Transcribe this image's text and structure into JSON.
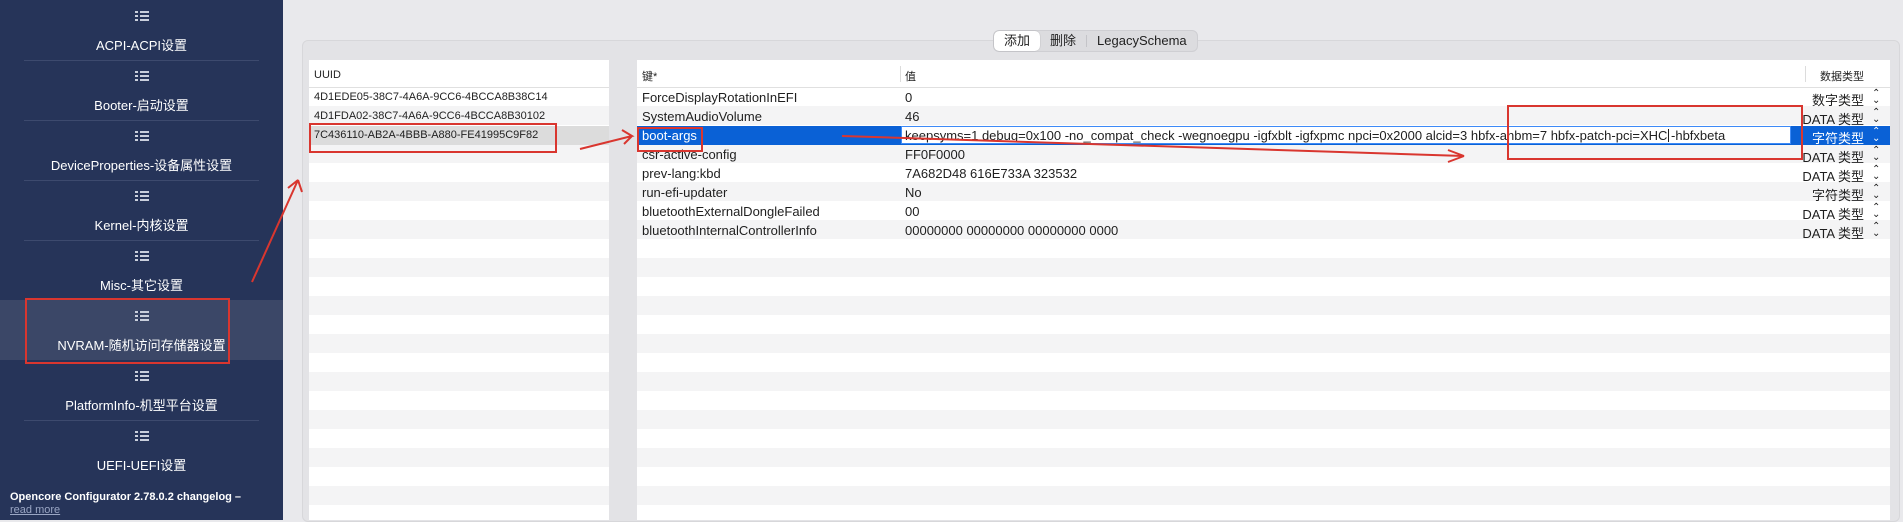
{
  "sidebar": {
    "items": [
      {
        "label": "ACPI-ACPI设置"
      },
      {
        "label": "Booter-启动设置"
      },
      {
        "label": "DeviceProperties-设备属性设置"
      },
      {
        "label": "Kernel-内核设置"
      },
      {
        "label": "Misc-其它设置"
      },
      {
        "label": "NVRAM-随机访问存储器设置"
      },
      {
        "label": "PlatformInfo-机型平台设置"
      },
      {
        "label": "UEFI-UEFI设置"
      }
    ],
    "selected_index": 5,
    "changelog": "Opencore Configurator 2.78.0.2 changelog –",
    "read_more": "read more"
  },
  "toolbar": {
    "add": "添加",
    "delete": "删除",
    "legacy": "LegacySchema"
  },
  "uuid_table": {
    "header": "UUID",
    "rows": [
      "4D1EDE05-38C7-4A6A-9CC6-4BCCA8B38C14",
      "4D1FDA02-38C7-4A6A-9CC6-4BCCA8B30102",
      "7C436110-AB2A-4BBB-A880-FE41995C9F82"
    ],
    "selected_index": 2
  },
  "nvram_table": {
    "headers": {
      "key": "键*",
      "value": "值",
      "type": "数据类型"
    },
    "rows": [
      {
        "key": "ForceDisplayRotationInEFI",
        "value": "0",
        "type": "数字类型"
      },
      {
        "key": "SystemAudioVolume",
        "value": "46",
        "type": "DATA 类型"
      },
      {
        "key": "boot-args",
        "value": "keepsyms=1 debug=0x100 -no_compat_check -wegnoegpu -igfxblt -igfxpmc npci=0x2000 alcid=3  hbfx-ahbm=7 hbfx-patch-pci=XHC -hbfxbeta",
        "type": "字符类型"
      },
      {
        "key": "csr-active-config",
        "value": "FF0F0000",
        "type": "DATA 类型"
      },
      {
        "key": "prev-lang:kbd",
        "value": "7A682D48 616E733A 323532",
        "type": "DATA 类型"
      },
      {
        "key": "run-efi-updater",
        "value": "No",
        "type": "字符类型"
      },
      {
        "key": "bluetoothExternalDongleFailed",
        "value": "00",
        "type": "DATA 类型"
      },
      {
        "key": "bluetoothInternalControllerInfo",
        "value": "00000000 00000000 00000000 0000",
        "type": "DATA 类型"
      }
    ],
    "selected_index": 2,
    "chevron": "⌃⌄"
  },
  "colors": {
    "sidebar_bg": "#263459",
    "selection_blue": "#0a61d6",
    "annotation_red": "#d9362f"
  }
}
